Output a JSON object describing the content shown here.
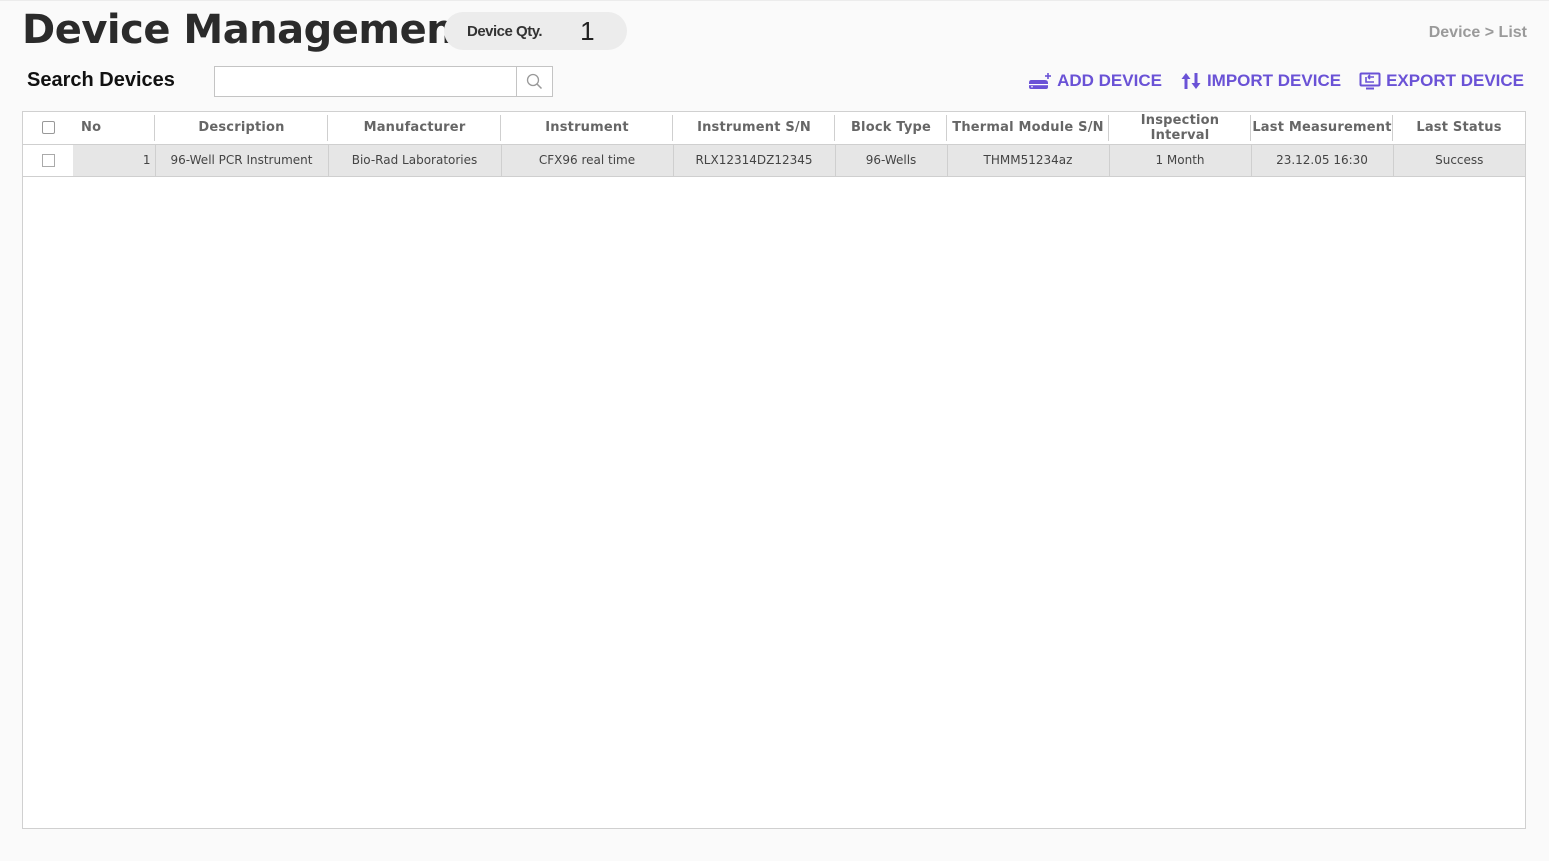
{
  "header": {
    "title": "Device Management",
    "qty_label": "Device Qty.",
    "qty_value": "1",
    "breadcrumb": "Device > List"
  },
  "search": {
    "label": "Search Devices",
    "value": "",
    "placeholder": "",
    "icon": "search-icon"
  },
  "actions": [
    {
      "label": "ADD DEVICE",
      "icon": "add-device-icon"
    },
    {
      "label": "IMPORT DEVICE",
      "icon": "import-arrows-icon"
    },
    {
      "label": "EXPORT DEVICE",
      "icon": "export-monitor-icon"
    }
  ],
  "accent_color": "#6a52d6",
  "table": {
    "columns": [
      "No",
      "Description",
      "Manufacturer",
      "Instrument",
      "Instrument S/N",
      "Block Type",
      "Thermal Module S/N",
      "Inspection Interval",
      "Last Measurement",
      "Last Status"
    ],
    "rows": [
      {
        "no": "1",
        "description": "96-Well PCR Instrument",
        "manufacturer": "Bio-Rad Laboratories",
        "instrument": "CFX96 real time",
        "instrument_sn": "RLX12314DZ12345",
        "block_type": "96-Wells",
        "thermal_module_sn": "THMM51234az",
        "inspection_interval": "1 Month",
        "last_measurement": "23.12.05 16:30",
        "last_status": "Success"
      }
    ]
  }
}
